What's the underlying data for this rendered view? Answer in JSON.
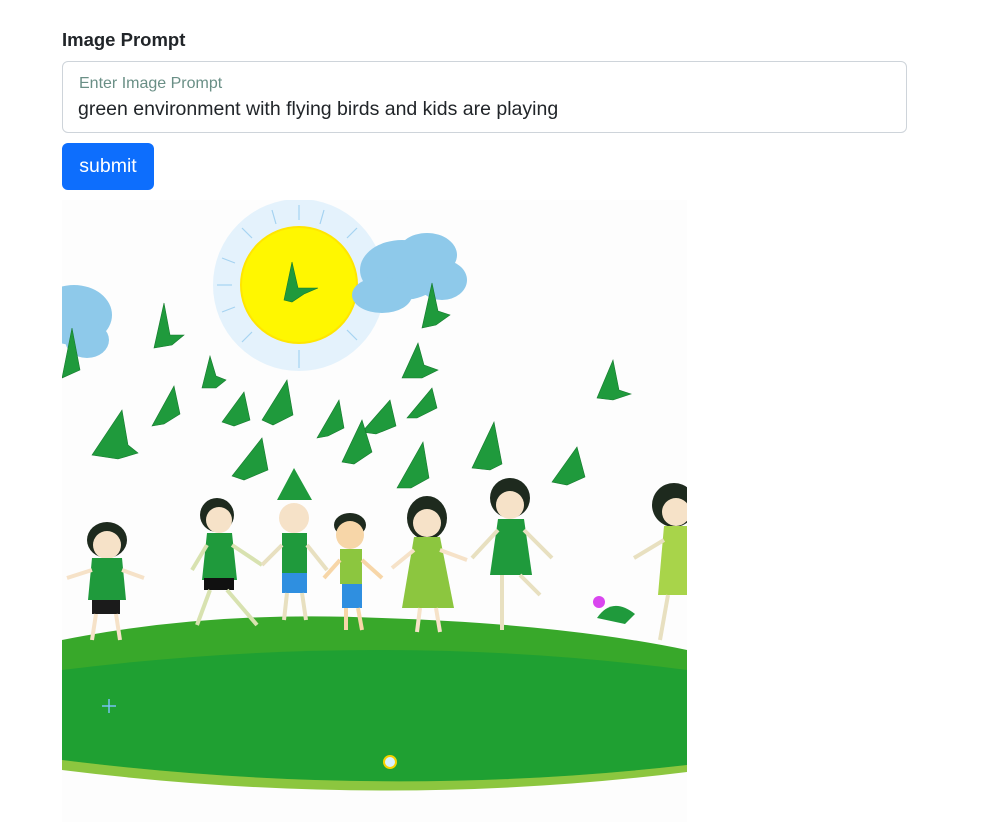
{
  "form": {
    "label": "Image Prompt",
    "prompt_placeholder": "Enter Image Prompt",
    "prompt_value": "green environment with flying birds and kids are playing",
    "submit_label": "submit"
  },
  "generated_image": {
    "alt": "green environment with flying birds and kids are playing"
  }
}
